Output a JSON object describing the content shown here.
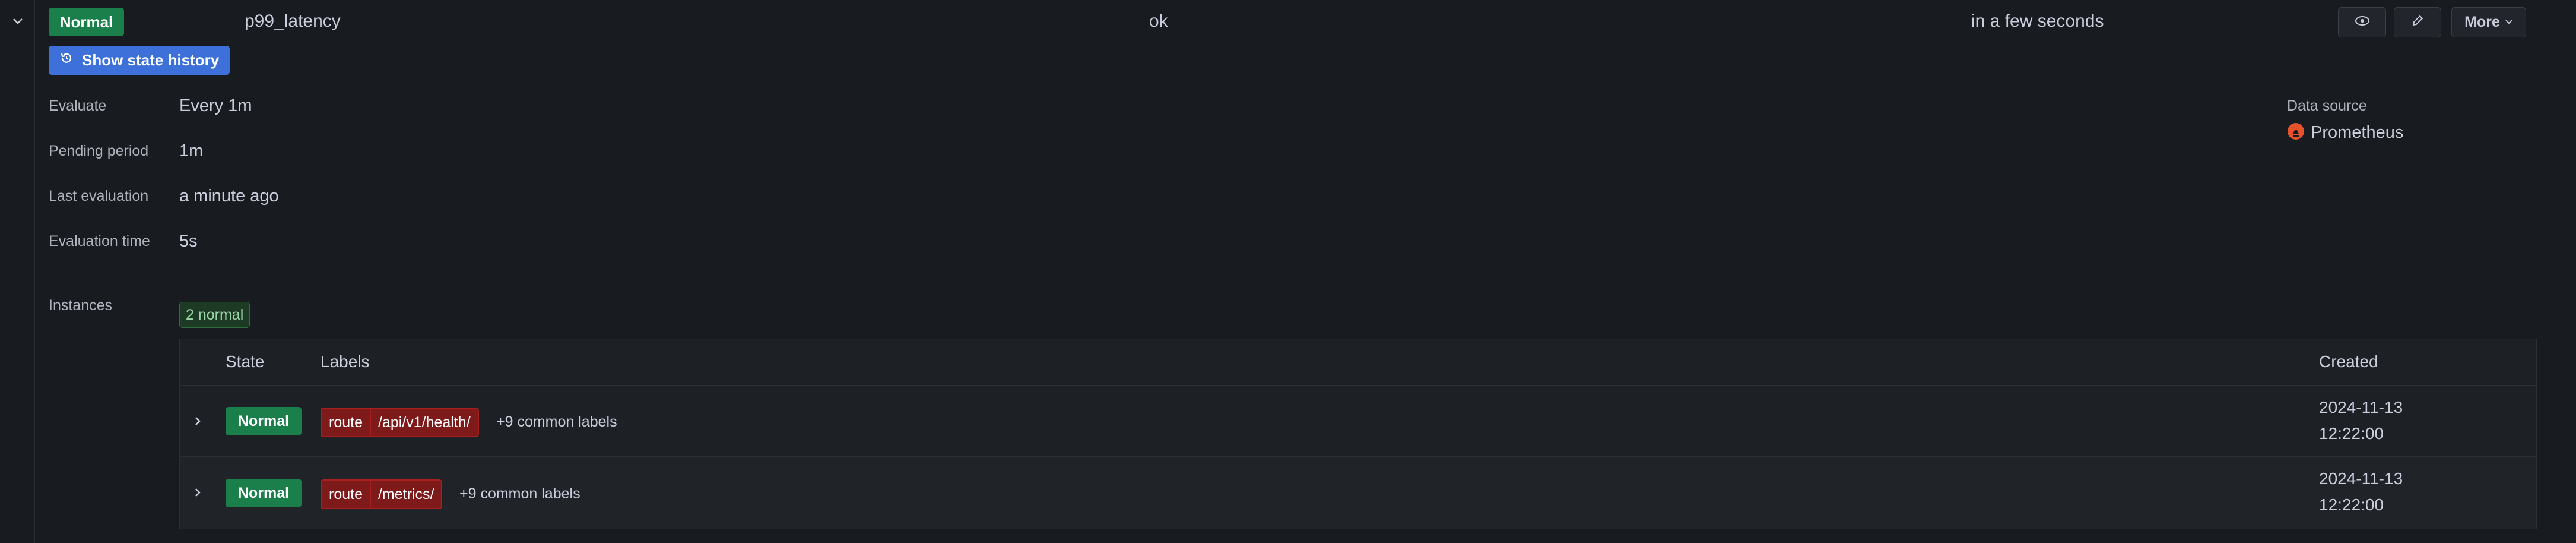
{
  "rule": {
    "state": "Normal",
    "name": "p99_latency",
    "health": "ok",
    "next_eval": "in a few seconds",
    "more_label": "More",
    "show_history_label": "Show state history"
  },
  "details": {
    "evaluate_label": "Evaluate",
    "evaluate_value": "Every 1m",
    "pending_label": "Pending period",
    "pending_value": "1m",
    "last_eval_label": "Last evaluation",
    "last_eval_value": "a minute ago",
    "eval_time_label": "Evaluation time",
    "eval_time_value": "5s",
    "datasource_label": "Data source",
    "datasource_value": "Prometheus"
  },
  "instances": {
    "label": "Instances",
    "count_badge": "2 normal",
    "columns": [
      "State",
      "Labels",
      "Created"
    ],
    "rows": [
      {
        "state": "Normal",
        "label_key": "route",
        "label_value": "/api/v1/health/",
        "common": "+9 common labels",
        "created_date": "2024-11-13",
        "created_time": "12:22:00"
      },
      {
        "state": "Normal",
        "label_key": "route",
        "label_value": "/metrics/",
        "common": "+9 common labels",
        "created_date": "2024-11-13",
        "created_time": "12:22:00"
      }
    ]
  },
  "colors": {
    "background": "#181b1f",
    "normal_badge": "#1a7f4b",
    "primary_button": "#3d71d9",
    "label_chip": "#7e1a1a",
    "prometheus": "#e6522c"
  }
}
